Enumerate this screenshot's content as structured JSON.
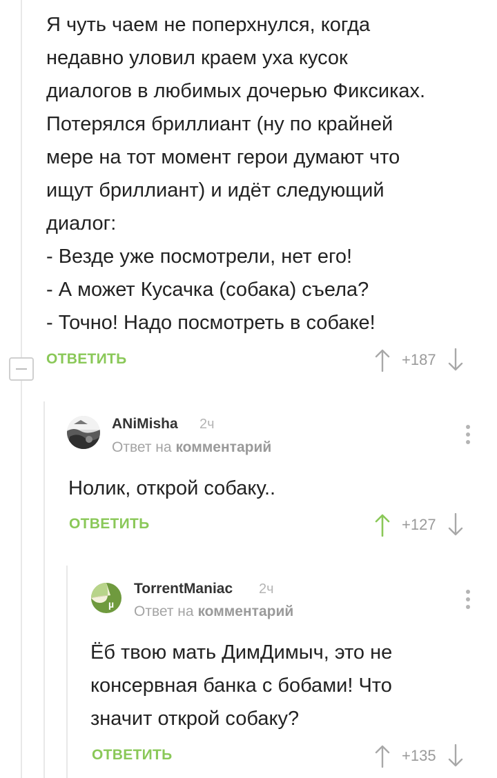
{
  "colors": {
    "accent_green": "#8ac858",
    "muted_gray": "#9a9a9a",
    "thread_line": "#e8e8e8"
  },
  "root_comment": {
    "lines": [
      "Я чуть чаем не поперхнулся, когда",
      "недавно уловил краем уха кусок",
      "диалогов в любимых дочерью Фиксиках.",
      "Потерялся бриллиант (ну по крайней",
      "мере на тот момент герои думают что",
      "ищут бриллиант) и идёт следующий",
      "диалог:",
      "- Везде уже посмотрели, нет его!",
      "- А может Кусачка (собака) съела?",
      "- Точно! Надо посмотреть в собаке!"
    ],
    "reply_label": "ОТВЕТИТЬ",
    "rating": "+187",
    "icons": [
      "arrow-up-icon",
      "arrow-down-icon",
      "collapse-minus-icon"
    ]
  },
  "reply_1": {
    "author": "ANiMisha",
    "time": "2ч",
    "reply_prefix": "Ответ на",
    "reply_target": "комментарий",
    "text": "Нолик, открой собаку..",
    "reply_label": "ОТВЕТИТЬ",
    "rating": "+127",
    "upvoted": true,
    "icons": [
      "avatar-photo",
      "more-vertical-icon",
      "arrow-up-icon",
      "arrow-down-icon"
    ]
  },
  "reply_2": {
    "author": "TorrentManiac",
    "time": "2ч",
    "reply_prefix": "Ответ на",
    "reply_target": "комментарий",
    "lines": [
      "Ёб твою мать ДимДимыч, это не",
      "консервная банка с бобами! Что",
      "значит открой собаку?"
    ],
    "reply_label": "ОТВЕТИТЬ",
    "rating": "+135",
    "icons": [
      "avatar-peeling-sticker",
      "more-vertical-icon",
      "arrow-up-icon",
      "arrow-down-icon"
    ]
  }
}
